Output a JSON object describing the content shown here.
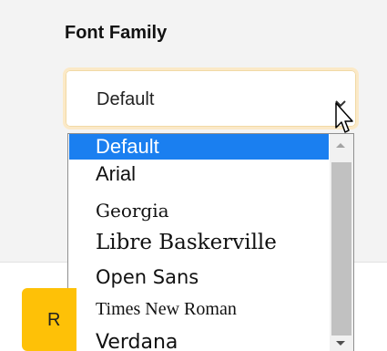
{
  "font_family_field": {
    "label": "Font Family",
    "selected_value": "Default",
    "options": [
      "Default",
      "Arial",
      "Georgia",
      "Libre Baskerville",
      "Open Sans",
      "Times New Roman",
      "Verdana"
    ],
    "highlighted_index": 0
  },
  "button": {
    "label_visible": "R"
  },
  "colors": {
    "panel_background": "#f3f3f3",
    "select_border": "#fbe9c7",
    "option_highlight": "#1a7ff0",
    "button_background": "#fec107"
  },
  "icons": {
    "select_chevron": "chevron-down-icon",
    "scroll_up": "scroll-up-arrow-icon",
    "scroll_down": "scroll-down-arrow-icon",
    "cursor": "mouse-pointer-icon"
  }
}
